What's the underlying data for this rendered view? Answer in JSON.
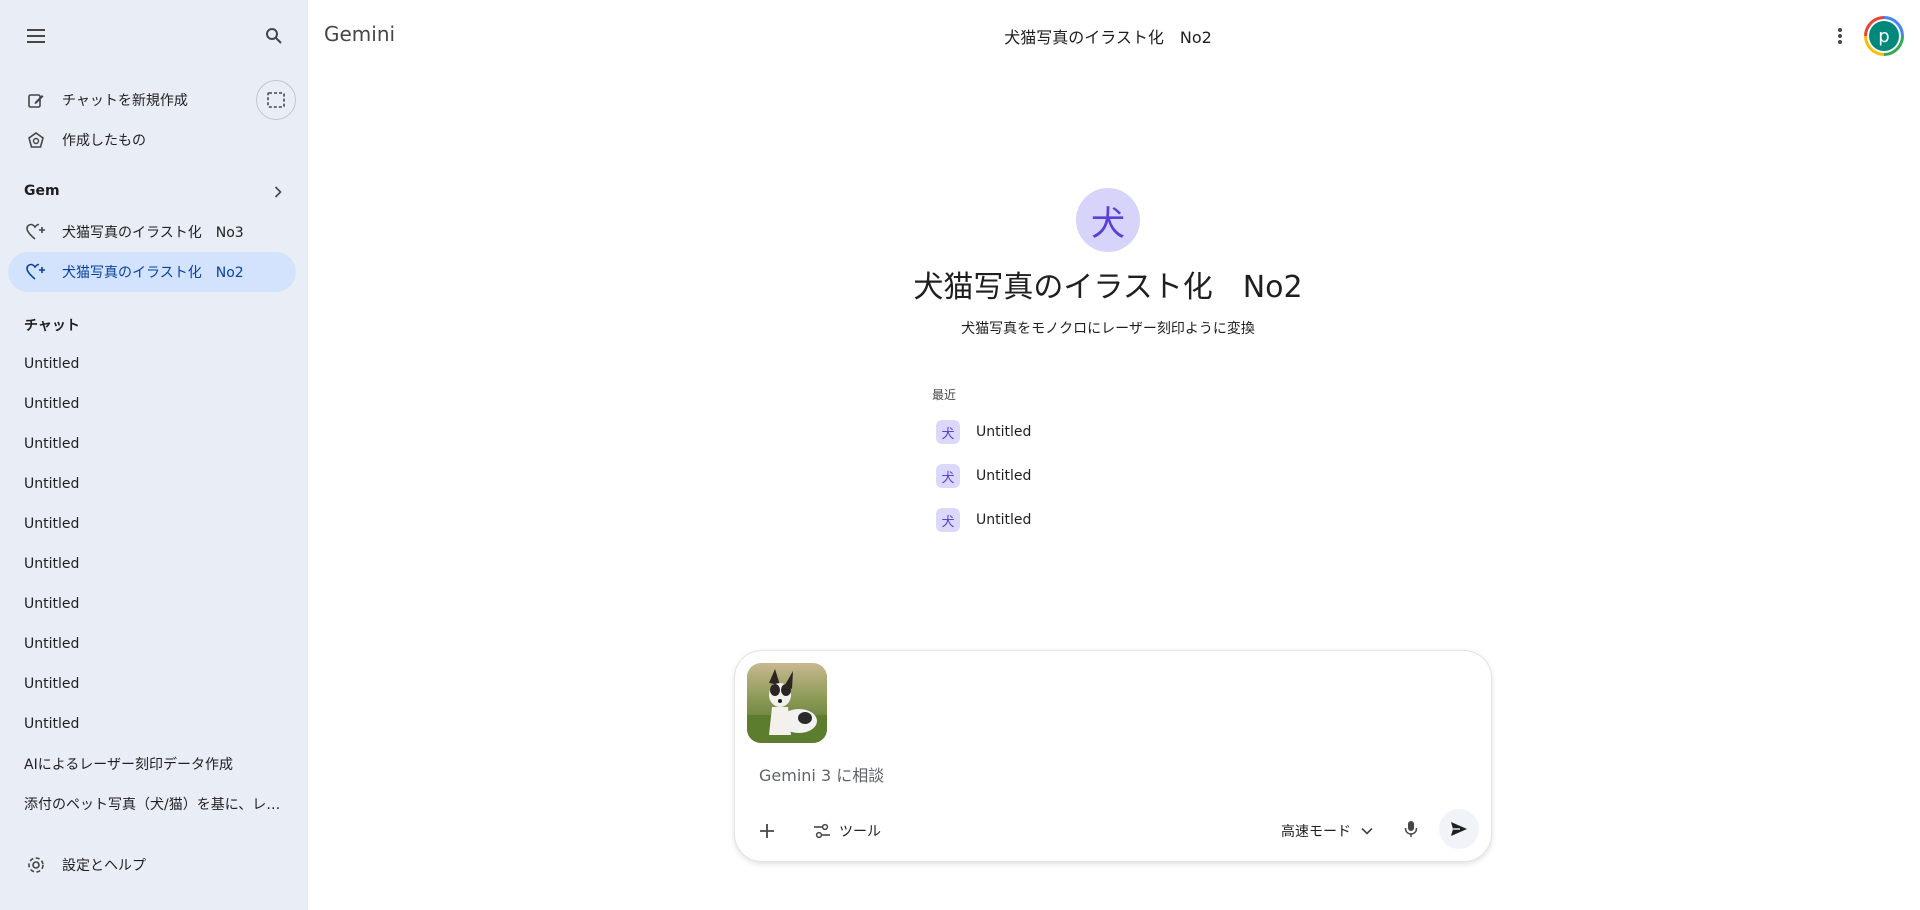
{
  "app": {
    "brand": "Gemini",
    "header_title": "犬猫写真のイラスト化　No2",
    "avatar_letter": "p"
  },
  "sidebar": {
    "new_chat": "チャットを新規作成",
    "created": "作成したもの",
    "gem_header": "Gem",
    "gems": [
      {
        "label": "犬猫写真のイラスト化　No3",
        "active": false
      },
      {
        "label": "犬猫写真のイラスト化　No2",
        "active": true
      }
    ],
    "chat_header": "チャット",
    "chats": [
      "Untitled",
      "Untitled",
      "Untitled",
      "Untitled",
      "Untitled",
      "Untitled",
      "Untitled",
      "Untitled",
      "Untitled",
      "Untitled",
      "AIによるレーザー刻印データ作成",
      "添付のペット写真（犬/猫）を基に、レーザー刻印用..."
    ],
    "settings": "設定とヘルプ"
  },
  "gem": {
    "avatar_char": "犬",
    "title": "犬猫写真のイラスト化　No2",
    "description": "犬猫写真をモノクロにレーザー刻印ように変換",
    "recent_label": "最近",
    "recent": [
      {
        "icon": "犬",
        "label": "Untitled"
      },
      {
        "icon": "犬",
        "label": "Untitled"
      },
      {
        "icon": "犬",
        "label": "Untitled"
      }
    ]
  },
  "composer": {
    "placeholder": "Gemini 3 に相談",
    "value": "",
    "tools_label": "ツール",
    "mode_label": "高速モード"
  },
  "colors": {
    "sidebar_bg": "#e9eef6",
    "active_bg": "#d3e3fd",
    "gem_accent": "#5b3fd6",
    "avatar_bg": "#00897b"
  }
}
